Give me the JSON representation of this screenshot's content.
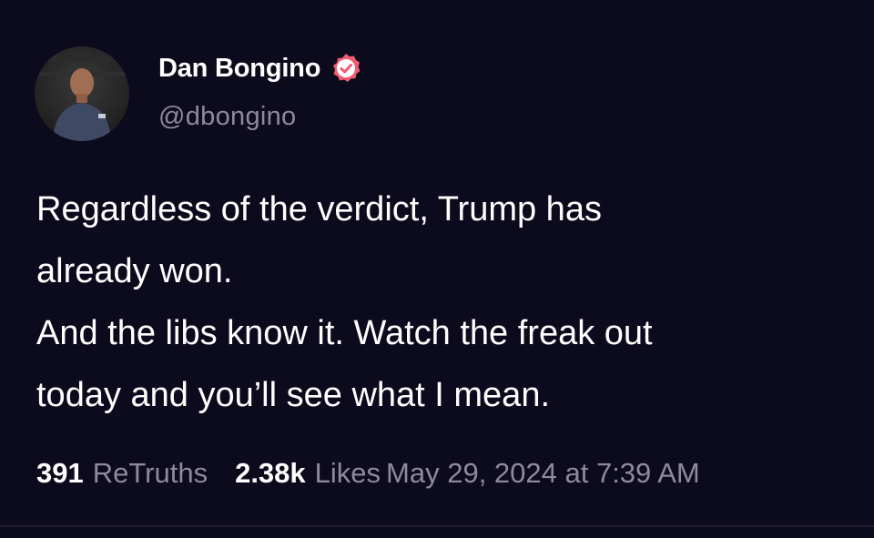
{
  "author": {
    "display_name": "Dan Bongino",
    "handle": "@dbongino",
    "verified": true,
    "avatar_icon": "profile-photo"
  },
  "post": {
    "body_lines": [
      "Regardless of the verdict, Trump has",
      "already won.",
      "And the libs know it. Watch the freak out",
      "today and you’ll see what I mean."
    ]
  },
  "stats": {
    "retruths_count": "391",
    "retruths_label": "ReTruths",
    "likes_count": "2.38k",
    "likes_label": "Likes",
    "timestamp": "May 29, 2024 at 7:39 AM"
  },
  "colors": {
    "background": "#0c0a1d",
    "text_primary": "#ffffff",
    "text_secondary": "#8d8a9c",
    "verified_badge": "#f25c73"
  }
}
